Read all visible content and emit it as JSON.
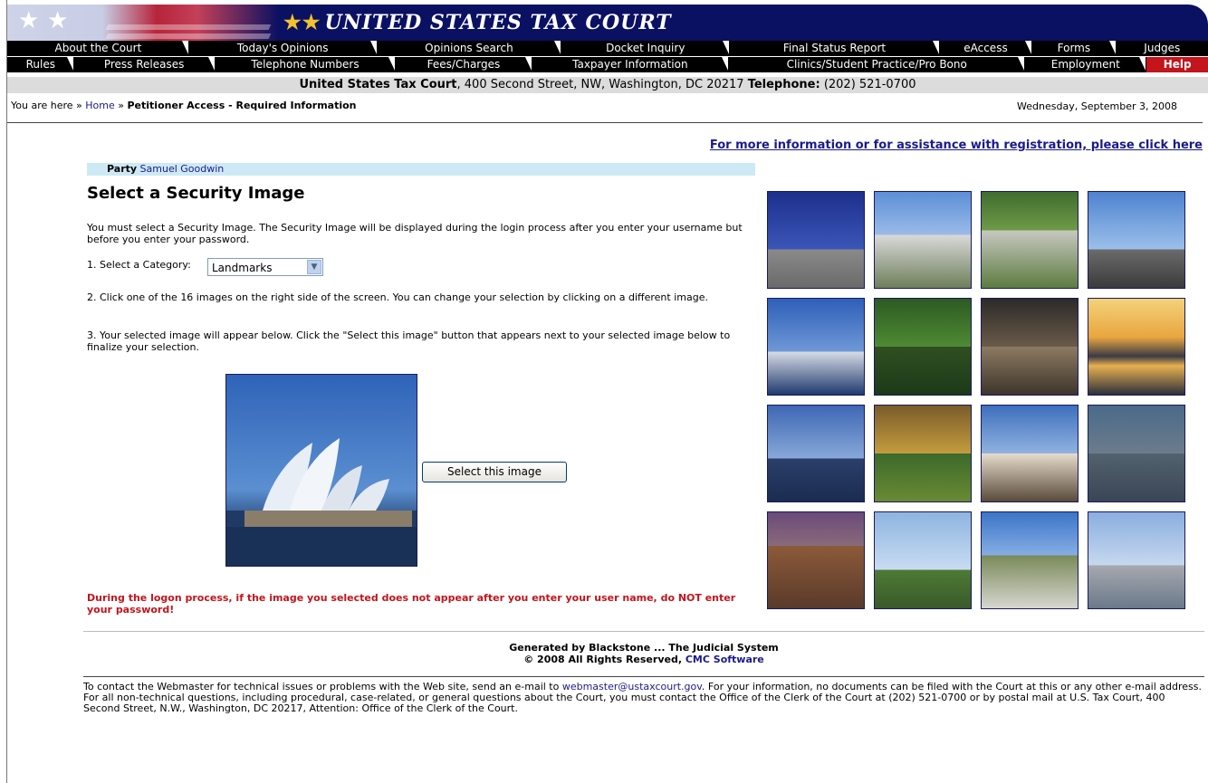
{
  "banner": {
    "title": "UNITED STATES TAX COURT"
  },
  "nav": {
    "row1": [
      "About the Court",
      "Today's Opinions",
      "Opinions Search",
      "Docket Inquiry",
      "Final Status Report",
      "eAccess",
      "Forms",
      "Judges"
    ],
    "row2": [
      "Rules",
      "Press Releases",
      "Telephone Numbers",
      "Fees/Charges",
      "Taxpayer Information",
      "Clinics/Student Practice/Pro Bono",
      "Employment",
      "Help"
    ]
  },
  "address": {
    "name": "United States Tax Court",
    "street": ", 400 Second Street, NW, Washington, DC 20217 ",
    "tel_label": "Telephone:",
    "tel": " (202) 521-0700"
  },
  "breadcrumb": {
    "prefix": "You are here » ",
    "home": "Home",
    "sep": " » ",
    "current": "Petitioner Access - Required Information"
  },
  "date": "Wednesday, September 3, 2008",
  "more_info": "For more information or for assistance with registration, please click here",
  "party": {
    "label": "Party",
    "value": "Samuel Goodwin"
  },
  "heading": "Select a Security Image",
  "intro": "You must select a Security Image. The Security Image will be displayed during the login process after you enter your username but before you enter your password.",
  "step1_label": "1. Select a Category:",
  "category": {
    "selected": "Landmarks"
  },
  "step2": "2. Click one of the 16 images on the right side of the screen. You can change your selection by clicking on a different image.",
  "step3": "3. Your selected image will appear below. Click the \"Select this image\" button that appears next to your selected image below to finalize your selection.",
  "select_button": "Select this image",
  "warning": "During the logon process, if the image you selected does not appear after you enter your user name, do NOT enter your password!",
  "generated": {
    "line1": "Generated by Blackstone ... The Judicial System",
    "line2": "© 2008 All Rights Reserved, ",
    "vendor": "CMC Software"
  },
  "footer": {
    "pre": "To contact the Webmaster for technical issues or problems with the Web site, send an e-mail to ",
    "email": "webmaster@ustaxcourt.gov",
    "post": ". For your information, no documents can be filed with the Court at this or any other e-mail address. For all non-technical questions, including procedural, case-related, or general questions about the Court, you must contact the Office of the Clerk of the Court at (202) 521-0700 or by postal mail at U.S. Tax Court, 400 Second Street, N.W., Washington, DC 20217, Attention: Office of the Clerk of the Court."
  },
  "images": [
    {
      "name": "flags-plaza-image"
    },
    {
      "name": "opera-house-aerial-image"
    },
    {
      "name": "cemetery-image"
    },
    {
      "name": "town-hall-image"
    },
    {
      "name": "opera-house-harbor-image"
    },
    {
      "name": "ivy-arch-image"
    },
    {
      "name": "lincoln-memorial-image"
    },
    {
      "name": "skyline-sunset-image"
    },
    {
      "name": "harbour-bridge-image"
    },
    {
      "name": "temple-interior-image"
    },
    {
      "name": "taj-mahal-reflection-image"
    },
    {
      "name": "texture-wall-image"
    },
    {
      "name": "colosseum-image"
    },
    {
      "name": "monument-tower-image"
    },
    {
      "name": "mountain-ruins-image"
    },
    {
      "name": "taj-mahal-haze-image"
    }
  ]
}
